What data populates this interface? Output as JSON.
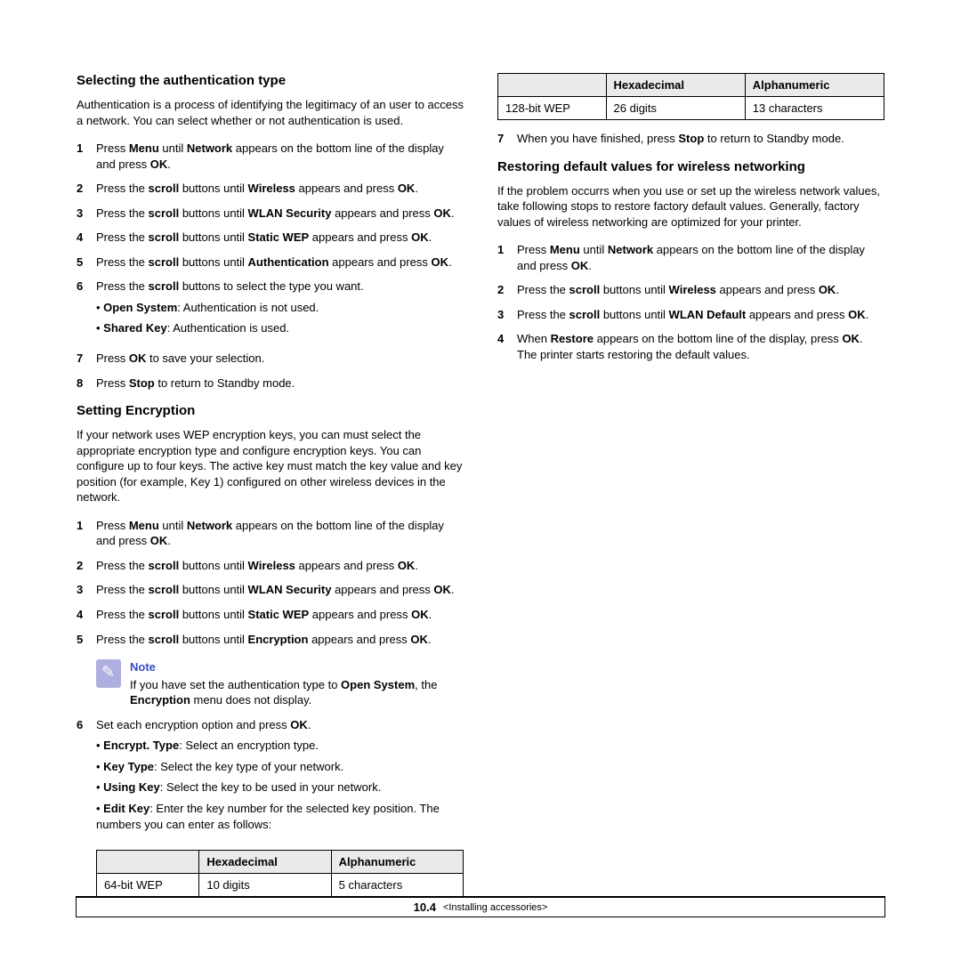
{
  "leftCol": {
    "h1": "Selecting the authentication type",
    "p1": "Authentication is a process of identifying the legitimacy of an user to access a network. You can select whether or not authentication is used.",
    "steps1": [
      {
        "n": "1",
        "html": "Press <b>Menu</b> until <b>Network</b> appears on the bottom line of the display and press <b>OK</b>."
      },
      {
        "n": "2",
        "html": "Press the <b>scroll</b> buttons until <b>Wireless</b> appears and press <b>OK</b>."
      },
      {
        "n": "3",
        "html": "Press the <b>scroll</b> buttons until <b>WLAN Security</b> appears and press <b>OK</b>."
      },
      {
        "n": "4",
        "html": "Press the <b>scroll</b> buttons until <b>Static WEP</b> appears and press <b>OK</b>."
      },
      {
        "n": "5",
        "html": "Press the <b>scroll</b> buttons until <b>Authentication</b> appears and press <b>OK</b>."
      },
      {
        "n": "6",
        "html": "Press the <b>scroll</b> buttons to select the type you want.",
        "bullets": [
          "<b>Open System</b>: Authentication is not used.",
          "<b>Shared Key</b>: Authentication is used."
        ]
      },
      {
        "n": "7",
        "html": "Press <b>OK</b> to save your selection."
      },
      {
        "n": "8",
        "html": "Press <b>Stop</b> to return to Standby mode."
      }
    ],
    "h2": "Setting Encryption",
    "p2": "If your network uses WEP encryption keys, you can must select the appropriate encryption type and configure encryption keys. You can configure up to four keys. The active key must match the key value and key position (for example, Key 1) configured on other wireless devices in the network.",
    "steps2": [
      {
        "n": "1",
        "html": "Press <b>Menu</b> until <b>Network</b> appears on the bottom line of the display and press <b>OK</b>."
      },
      {
        "n": "2",
        "html": "Press the <b>scroll</b> buttons until <b>Wireless</b> appears and press <b>OK</b>."
      },
      {
        "n": "3",
        "html": "Press the <b>scroll</b> buttons until <b>WLAN Security</b> appears and press <b>OK</b>."
      },
      {
        "n": "4",
        "html": "Press the <b>scroll</b> buttons until <b>Static WEP</b> appears and press <b>OK</b>."
      },
      {
        "n": "5",
        "html": "Press the <b>scroll</b> buttons until <b>Encryption</b> appears and press <b>OK</b>."
      }
    ],
    "noteTitle": "Note",
    "noteBody": "If you have set the authentication type to <b>Open System</b>, the <b>Encryption</b> menu does not display.",
    "steps2b": [
      {
        "n": "6",
        "html": "Set each encryption option and press <b>OK</b>.",
        "bullets": [
          "<b>Encrypt. Type</b>: Select an encryption type.",
          "<b>Key Type</b>: Select the key type of your network.",
          "<b>Using Key</b>: Select the key to be used in your network.",
          "<b>Edit Key</b>: Enter the key number for the selected key position. The numbers you can enter as follows:"
        ]
      }
    ],
    "table1": {
      "headers": [
        "",
        "Hexadecimal",
        "Alphanumeric"
      ],
      "row": [
        "64-bit WEP",
        "10 digits",
        "5 characters"
      ]
    }
  },
  "rightCol": {
    "table2": {
      "headers": [
        "",
        "Hexadecimal",
        "Alphanumeric"
      ],
      "row": [
        "128-bit WEP",
        "26 digits",
        "13 characters"
      ]
    },
    "step7": {
      "n": "7",
      "html": "When you have finished, press <b>Stop</b> to return to Standby mode."
    },
    "h3": "Restoring default values for wireless networking",
    "p3": "If the problem occurrs when you use or set up the wireless network values, take following stops to restore factory default values. Generally, factory values of wireless networking are optimized for your printer.",
    "steps3": [
      {
        "n": "1",
        "html": "Press <b>Menu</b> until <b>Network</b> appears on the bottom line of the display and press <b>OK</b>."
      },
      {
        "n": "2",
        "html": "Press the <b>scroll</b> buttons until <b>Wireless</b> appears and press <b>OK</b>."
      },
      {
        "n": "3",
        "html": "Press the <b>scroll</b> buttons until <b>WLAN Default</b> appears and press <b>OK</b>."
      },
      {
        "n": "4",
        "html": "When <b>Restore</b> appears on the bottom line of the display, press <b>OK</b>. The printer starts restoring the default values."
      }
    ]
  },
  "footer": {
    "page": "10.4",
    "chapter": "<Installing accessories>"
  }
}
